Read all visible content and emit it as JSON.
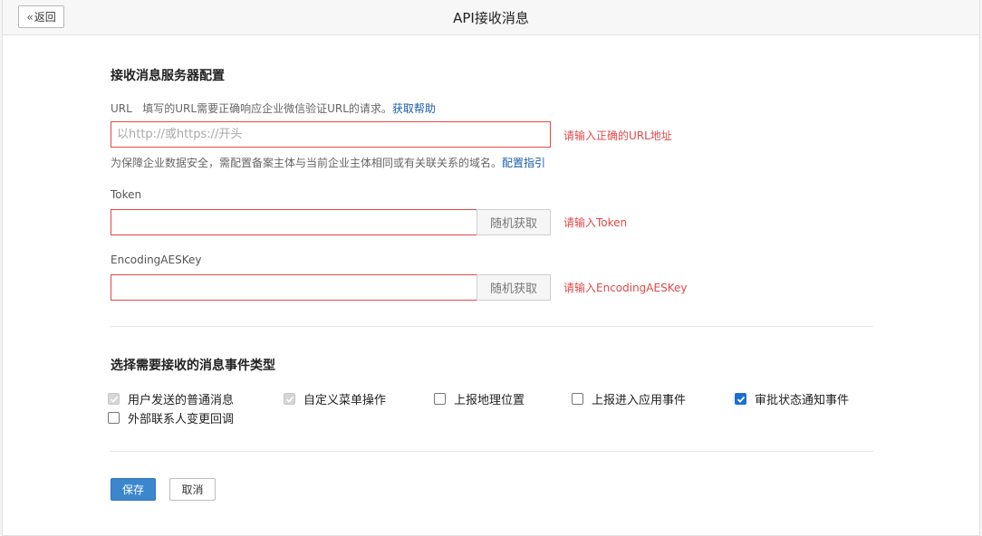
{
  "header": {
    "back_label": "返回",
    "title": "API接收消息"
  },
  "server_config": {
    "title": "接收消息服务器配置",
    "url": {
      "label": "URL",
      "hint": "填写的URL需要正确响应企业微信验证URL的请求。",
      "help_link": "获取帮助",
      "placeholder": "以http://或https://开头",
      "value": "",
      "error": "请输入正确的URL地址",
      "note": "为保障企业数据安全，需配置备案主体与当前企业主体相同或有关联关系的域名。",
      "note_link": "配置指引"
    },
    "token": {
      "label": "Token",
      "value": "",
      "random_button": "随机获取",
      "error": "请输入Token"
    },
    "aes_key": {
      "label": "EncodingAESKey",
      "value": "",
      "random_button": "随机获取",
      "error": "请输入EncodingAESKey"
    }
  },
  "events": {
    "title": "选择需要接收的消息事件类型",
    "options": [
      {
        "label": "用户发送的普通消息",
        "state": "checked-disabled"
      },
      {
        "label": "自定义菜单操作",
        "state": "checked-disabled"
      },
      {
        "label": "上报地理位置",
        "state": "unchecked"
      },
      {
        "label": "上报进入应用事件",
        "state": "unchecked"
      },
      {
        "label": "审批状态通知事件",
        "state": "checked"
      },
      {
        "label": "外部联系人变更回调",
        "state": "unchecked"
      }
    ]
  },
  "actions": {
    "save_label": "保存",
    "cancel_label": "取消"
  },
  "colors": {
    "accent": "#3c86cd",
    "error": "#e0494a",
    "link": "#1a5fa8",
    "checkbox_checked": "#1b6fd1"
  }
}
